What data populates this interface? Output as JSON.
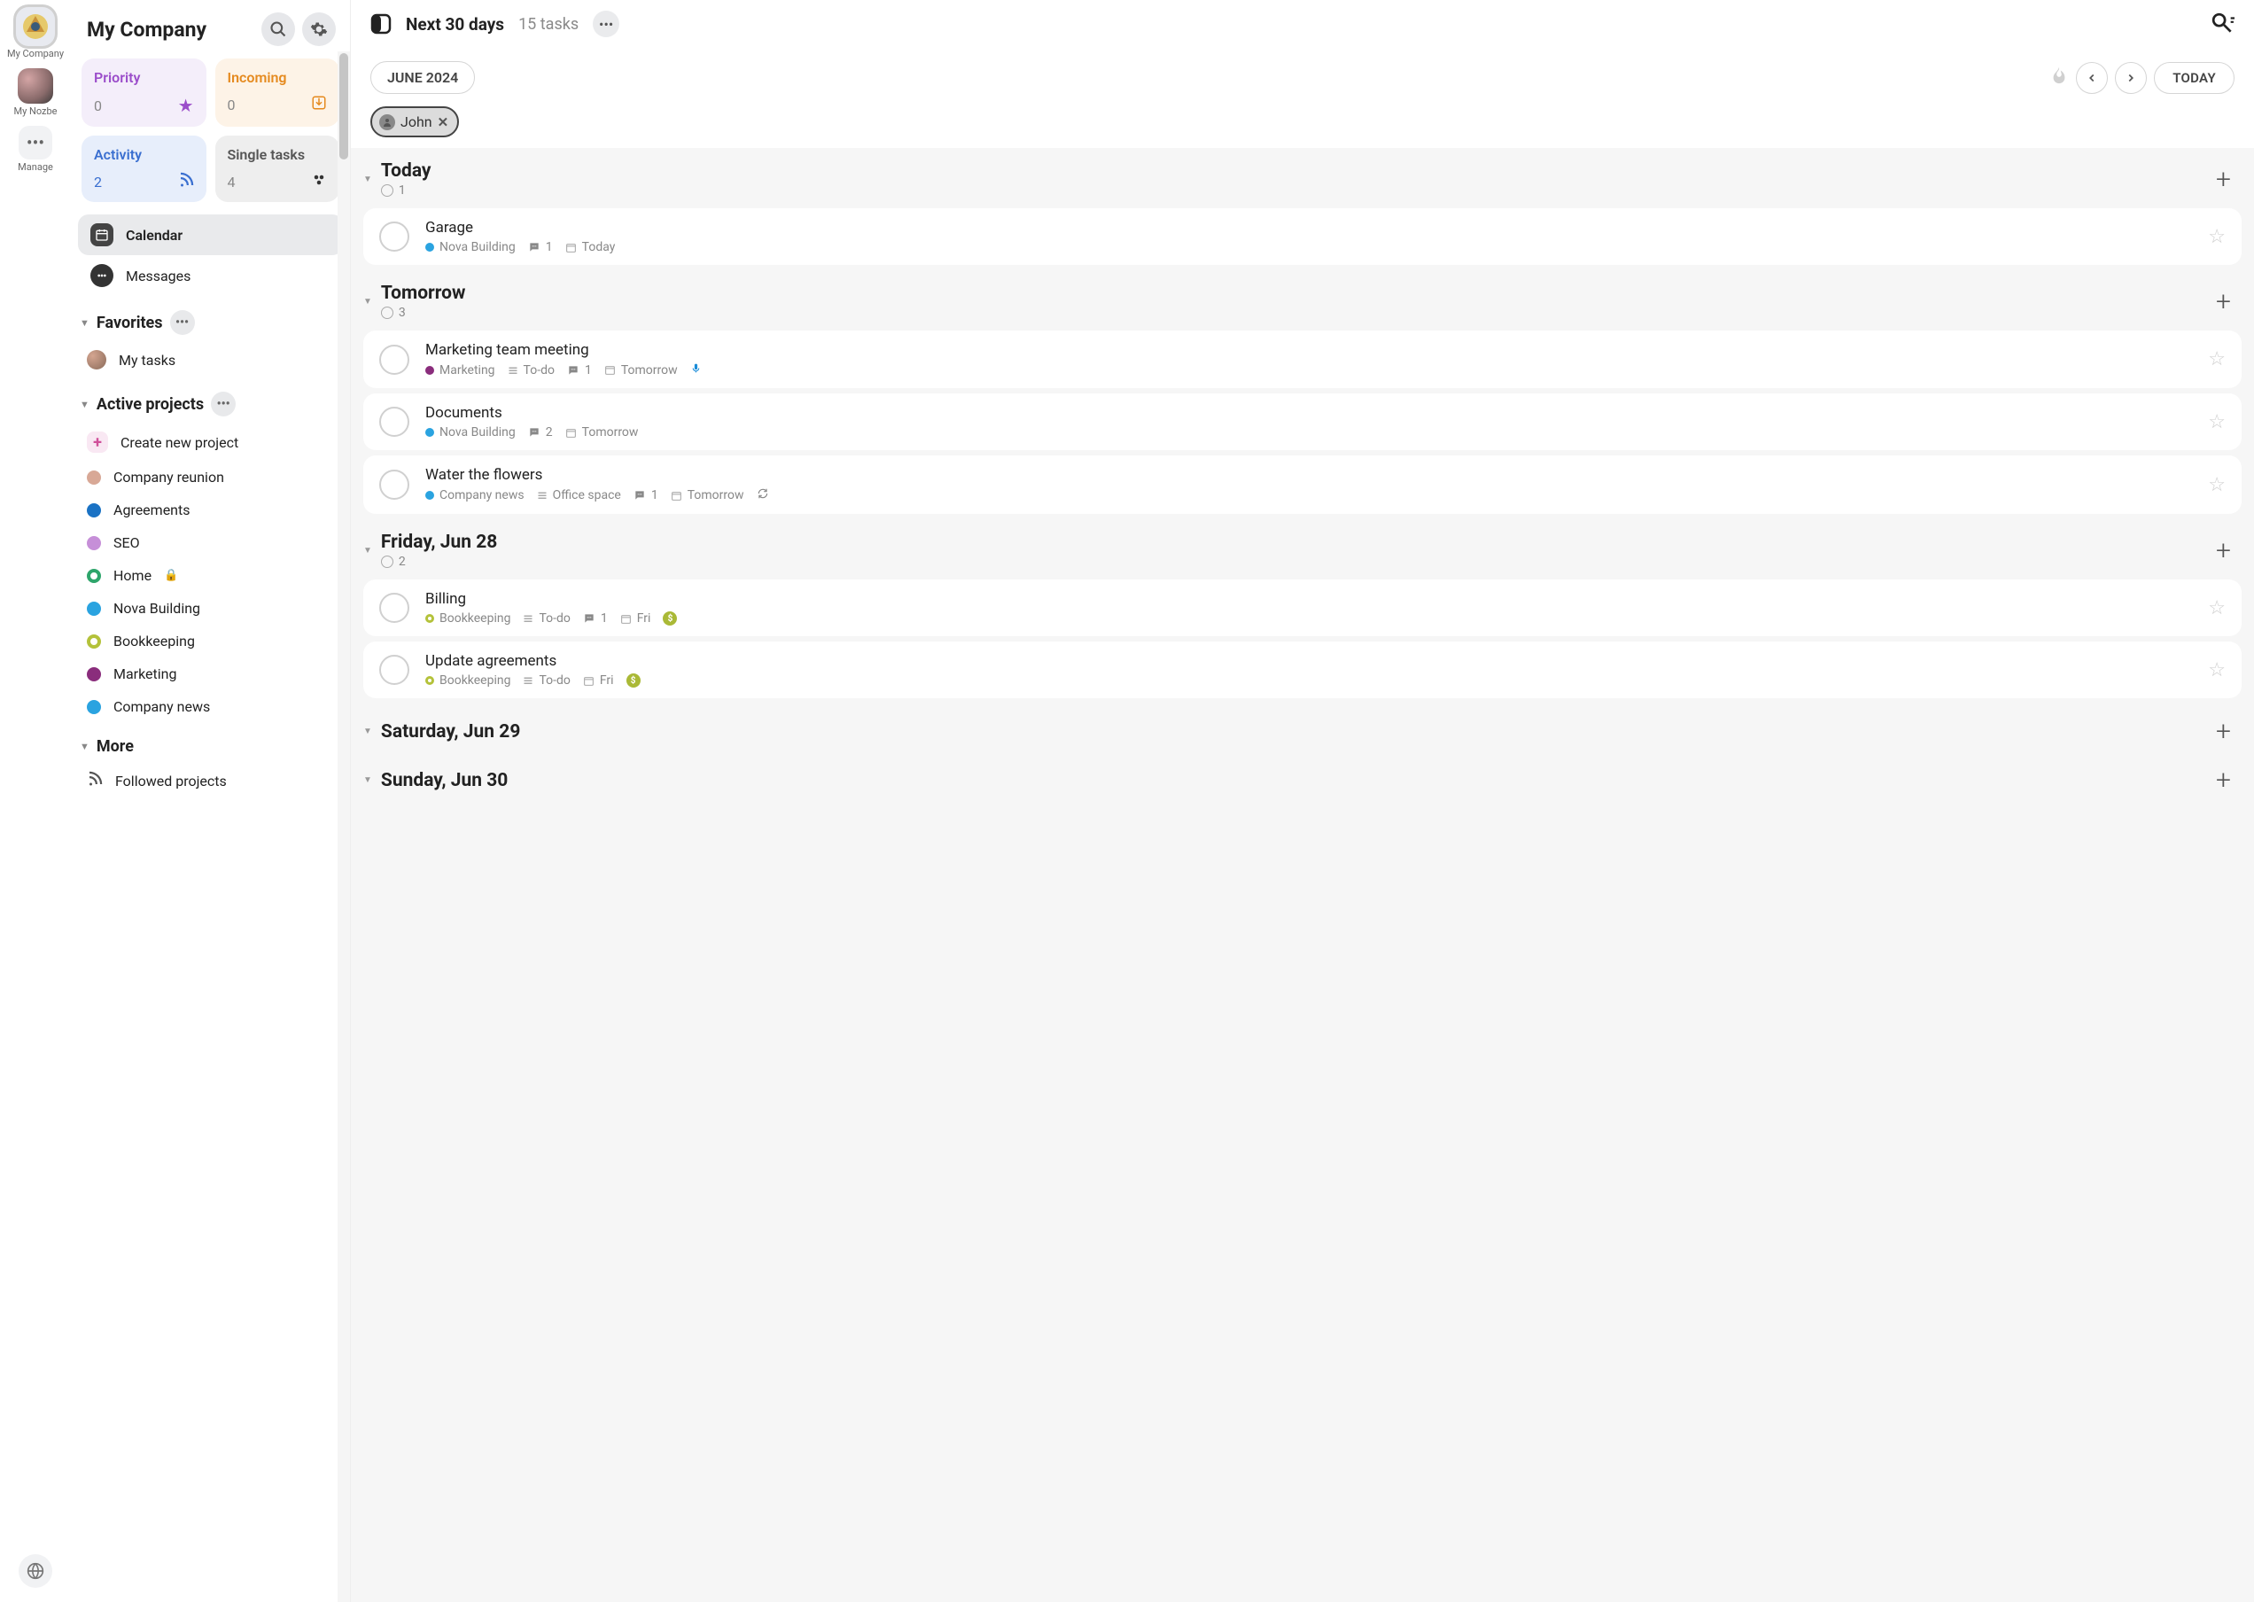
{
  "rail": {
    "company_label": "My Company",
    "nozbe_label": "My Nozbe",
    "manage_label": "Manage"
  },
  "sidebar": {
    "title": "My Company",
    "tiles": {
      "priority": {
        "title": "Priority",
        "count": "0"
      },
      "incoming": {
        "title": "Incoming",
        "count": "0"
      },
      "activity": {
        "title": "Activity",
        "count": "2"
      },
      "single": {
        "title": "Single tasks",
        "count": "4"
      }
    },
    "nav": {
      "calendar": "Calendar",
      "messages": "Messages"
    },
    "favorites": {
      "label": "Favorites",
      "items": [
        {
          "label": "My tasks"
        }
      ]
    },
    "active": {
      "label": "Active projects",
      "create": "Create new project",
      "items": [
        {
          "label": "Company reunion",
          "color": "#d8a896"
        },
        {
          "label": "Agreements",
          "color": "#1a72c4"
        },
        {
          "label": "SEO",
          "color": "#c68fd8"
        },
        {
          "label": "Home",
          "color": "#2ea56b",
          "locked": true,
          "ring": true
        },
        {
          "label": "Nova Building",
          "color": "#2aa3e0"
        },
        {
          "label": "Bookkeeping",
          "color": "#b4c23a",
          "ring": true
        },
        {
          "label": "Marketing",
          "color": "#8a2d7c"
        },
        {
          "label": "Company news",
          "color": "#2aa3e0"
        }
      ]
    },
    "more": {
      "label": "More",
      "followed": "Followed projects"
    }
  },
  "header": {
    "title": "Next 30 days",
    "count": "15 tasks"
  },
  "toolbar": {
    "month": "JUNE 2024",
    "today": "TODAY"
  },
  "filter": {
    "name": "John"
  },
  "colors": {
    "nova": "#2aa3e0",
    "marketing": "#8a2d7c",
    "company_news": "#2aa3e0",
    "bookkeeping": "#b4c23a"
  },
  "days": [
    {
      "title": "Today",
      "count": "1",
      "tasks": [
        {
          "title": "Garage",
          "project": "Nova Building",
          "pcolor": "nova",
          "comments": "1",
          "date": "Today"
        }
      ]
    },
    {
      "title": "Tomorrow",
      "count": "3",
      "tasks": [
        {
          "title": "Marketing team meeting",
          "project": "Marketing",
          "pcolor": "marketing",
          "section": "To-do",
          "comments": "1",
          "date": "Tomorrow",
          "mic": true
        },
        {
          "title": "Documents",
          "project": "Nova Building",
          "pcolor": "nova",
          "comments": "2",
          "date": "Tomorrow"
        },
        {
          "title": "Water the flowers",
          "project": "Company news",
          "pcolor": "company_news",
          "section": "Office space",
          "comments": "1",
          "date": "Tomorrow",
          "repeat": true
        }
      ]
    },
    {
      "title": "Friday, Jun 28",
      "count": "2",
      "tasks": [
        {
          "title": "Billing",
          "project": "Bookkeeping",
          "pcolor": "bookkeeping",
          "ring": true,
          "section": "To-do",
          "comments": "1",
          "date": "Fri",
          "money": true
        },
        {
          "title": "Update agreements",
          "project": "Bookkeeping",
          "pcolor": "bookkeeping",
          "ring": true,
          "section": "To-do",
          "date": "Fri",
          "money": true
        }
      ]
    },
    {
      "title": "Saturday, Jun 29",
      "tasks": []
    },
    {
      "title": "Sunday, Jun 30",
      "tasks": []
    }
  ]
}
